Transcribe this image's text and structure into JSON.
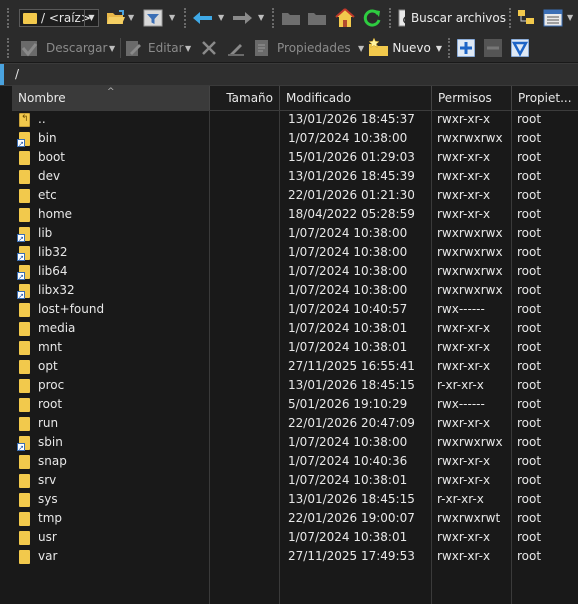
{
  "toolbar1": {
    "path_label": "/ <raíz>",
    "search_label": "Buscar archivos"
  },
  "toolbar2": {
    "download_label": "Descargar",
    "edit_label": "Editar",
    "properties_label": "Propiedades",
    "new_label": "Nuevo"
  },
  "breadcrumb": "/",
  "columns": {
    "name": "Nombre",
    "size": "Tamaño",
    "modified": "Modificado",
    "permissions": "Permisos",
    "owner": "Propiet..."
  },
  "rows": [
    {
      "name": "..",
      "modified": "13/01/2026 18:45:37",
      "permissions": "rwxr-xr-x",
      "owner": "root"
    },
    {
      "name": "bin",
      "modified": "1/07/2024 10:38:00",
      "permissions": "rwxrwxrwx",
      "owner": "root"
    },
    {
      "name": "boot",
      "modified": "15/01/2026 01:29:03",
      "permissions": "rwxr-xr-x",
      "owner": "root"
    },
    {
      "name": "dev",
      "modified": "13/01/2026 18:45:39",
      "permissions": "rwxr-xr-x",
      "owner": "root"
    },
    {
      "name": "etc",
      "modified": "22/01/2026 01:21:30",
      "permissions": "rwxr-xr-x",
      "owner": "root"
    },
    {
      "name": "home",
      "modified": "18/04/2022 05:28:59",
      "permissions": "rwxr-xr-x",
      "owner": "root"
    },
    {
      "name": "lib",
      "modified": "1/07/2024 10:38:00",
      "permissions": "rwxrwxrwx",
      "owner": "root"
    },
    {
      "name": "lib32",
      "modified": "1/07/2024 10:38:00",
      "permissions": "rwxrwxrwx",
      "owner": "root"
    },
    {
      "name": "lib64",
      "modified": "1/07/2024 10:38:00",
      "permissions": "rwxrwxrwx",
      "owner": "root"
    },
    {
      "name": "libx32",
      "modified": "1/07/2024 10:38:00",
      "permissions": "rwxrwxrwx",
      "owner": "root"
    },
    {
      "name": "lost+found",
      "modified": "1/07/2024 10:40:57",
      "permissions": "rwx------",
      "owner": "root"
    },
    {
      "name": "media",
      "modified": "1/07/2024 10:38:01",
      "permissions": "rwxr-xr-x",
      "owner": "root"
    },
    {
      "name": "mnt",
      "modified": "1/07/2024 10:38:01",
      "permissions": "rwxr-xr-x",
      "owner": "root"
    },
    {
      "name": "opt",
      "modified": "27/11/2025 16:55:41",
      "permissions": "rwxr-xr-x",
      "owner": "root"
    },
    {
      "name": "proc",
      "modified": "13/01/2026 18:45:15",
      "permissions": "r-xr-xr-x",
      "owner": "root"
    },
    {
      "name": "root",
      "modified": "5/01/2026 19:10:29",
      "permissions": "rwx------",
      "owner": "root"
    },
    {
      "name": "run",
      "modified": "22/01/2026 20:47:09",
      "permissions": "rwxr-xr-x",
      "owner": "root"
    },
    {
      "name": "sbin",
      "modified": "1/07/2024 10:38:00",
      "permissions": "rwxrwxrwx",
      "owner": "root"
    },
    {
      "name": "snap",
      "modified": "1/07/2024 10:40:36",
      "permissions": "rwxr-xr-x",
      "owner": "root"
    },
    {
      "name": "srv",
      "modified": "1/07/2024 10:38:01",
      "permissions": "rwxr-xr-x",
      "owner": "root"
    },
    {
      "name": "sys",
      "modified": "13/01/2026 18:45:15",
      "permissions": "r-xr-xr-x",
      "owner": "root"
    },
    {
      "name": "tmp",
      "modified": "22/01/2026 19:00:07",
      "permissions": "rwxrwxrwt",
      "owner": "root"
    },
    {
      "name": "usr",
      "modified": "1/07/2024 10:38:01",
      "permissions": "rwxr-xr-x",
      "owner": "root"
    },
    {
      "name": "var",
      "modified": "27/11/2025 17:49:53",
      "permissions": "rwxr-xr-x",
      "owner": "root"
    }
  ]
}
